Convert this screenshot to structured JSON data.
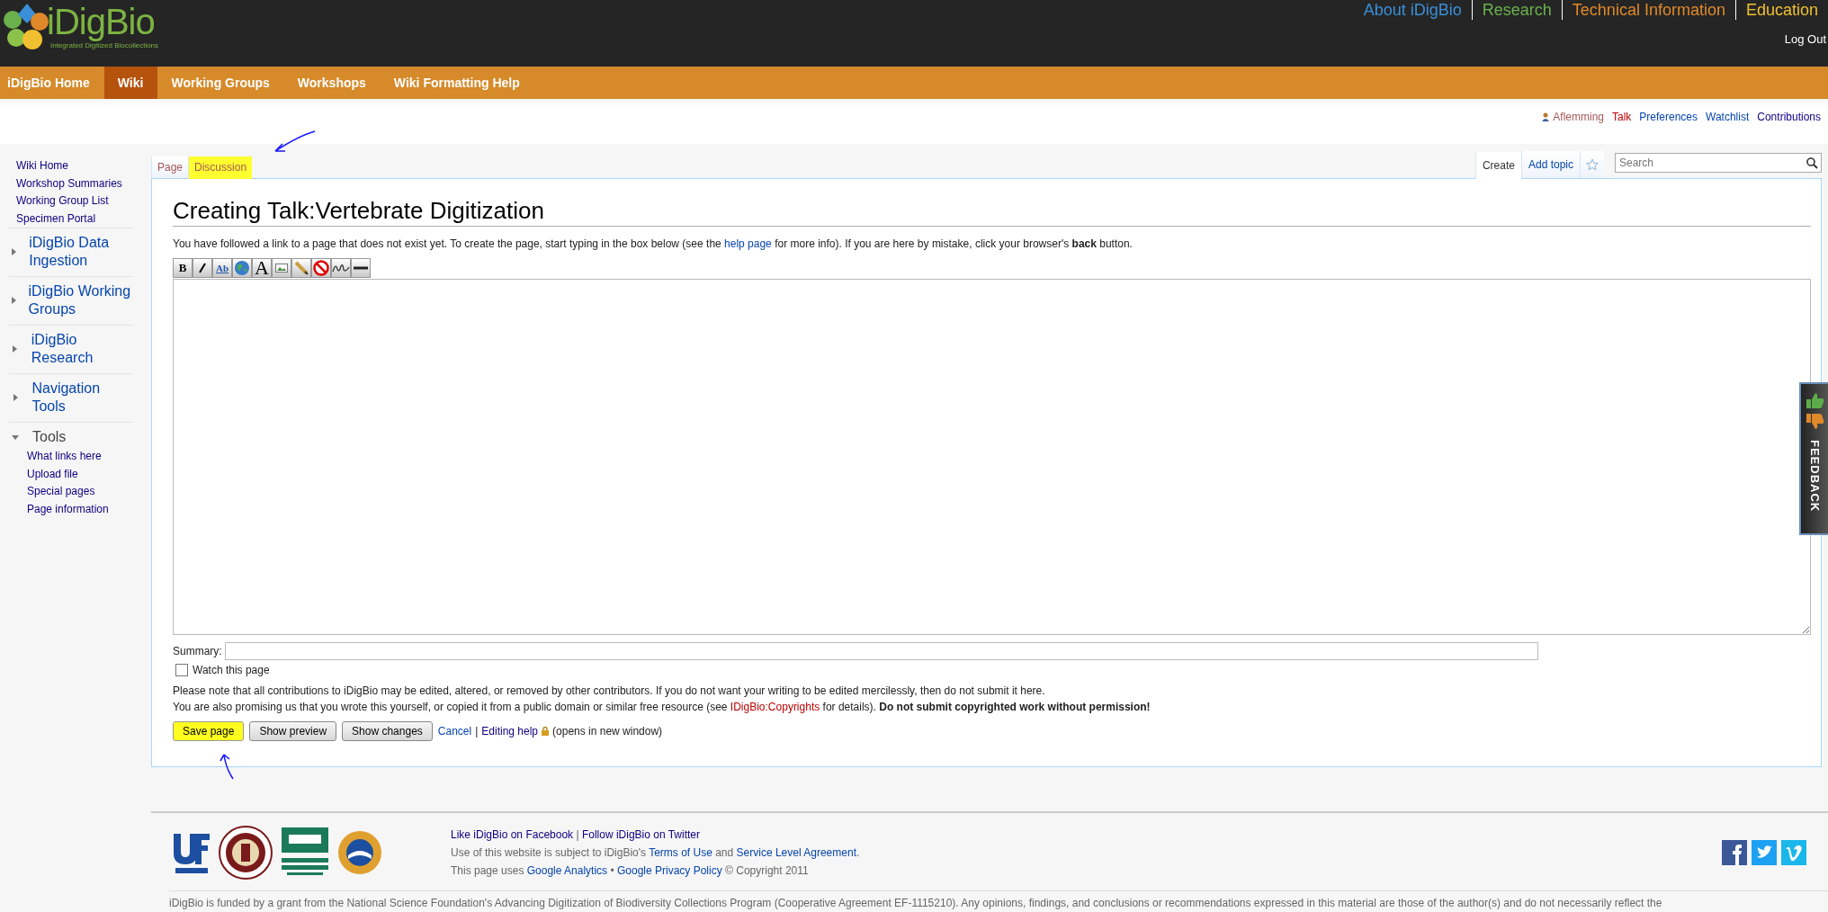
{
  "logo": {
    "name": "iDigBio",
    "tagline": "Integrated Digitized Biocollections"
  },
  "top_nav": [
    {
      "label": "About iDigBio",
      "color": "#3a8fd8"
    },
    {
      "label": "Research",
      "color": "#6ab04c"
    },
    {
      "label": "Technical Information",
      "color": "#e0892a"
    },
    {
      "label": "Education",
      "color": "#f0c030"
    }
  ],
  "logout": "Log Out",
  "main_nav": [
    {
      "label": "iDigBio Home",
      "selected": false
    },
    {
      "label": "Wiki",
      "selected": true
    },
    {
      "label": "Working Groups",
      "selected": false
    },
    {
      "label": "Workshops",
      "selected": false
    },
    {
      "label": "Wiki Formatting Help",
      "selected": false
    }
  ],
  "user_links": [
    {
      "label": "Aflemming",
      "kind": "user"
    },
    {
      "label": "Talk",
      "kind": "new"
    },
    {
      "label": "Preferences",
      "kind": "link"
    },
    {
      "label": "Watchlist",
      "kind": "link"
    },
    {
      "label": "Contributions",
      "kind": "visited"
    }
  ],
  "sidebar": {
    "links": [
      "Wiki Home",
      "Workshop Summaries",
      "Working Group List",
      "Specimen Portal"
    ],
    "portlets": [
      {
        "title": "iDigBio Data Ingestion",
        "expanded": false
      },
      {
        "title": "iDigBio Working Groups",
        "expanded": false
      },
      {
        "title": "iDigBio Research",
        "expanded": false
      },
      {
        "title": "Navigation Tools",
        "expanded": false
      },
      {
        "title": "Tools",
        "expanded": true,
        "children": [
          "What links here",
          "Upload file",
          "Special pages",
          "Page information"
        ]
      }
    ]
  },
  "tabs_left": [
    {
      "label": "Page",
      "selected": false,
      "highlighted": false
    },
    {
      "label": "Discussion",
      "selected": true,
      "highlighted": true
    }
  ],
  "tabs_right": [
    {
      "label": "Create",
      "selected": true
    },
    {
      "label": "Add topic",
      "selected": false
    }
  ],
  "search": {
    "placeholder": "Search"
  },
  "title": "Creating Talk:Vertebrate Digitization",
  "intro": {
    "before": "You have followed a link to a page that does not exist yet. To create the page, start typing in the box below (see the",
    "link": "help page",
    "after": "for more info). If you are here by mistake, click your browser's **back** button."
  },
  "toolbar": [
    {
      "kind": "bold",
      "label": "B"
    },
    {
      "kind": "italic"
    },
    {
      "kind": "link",
      "label": "Ab"
    },
    {
      "kind": "globe"
    },
    {
      "kind": "headline",
      "label": "A"
    },
    {
      "kind": "image"
    },
    {
      "kind": "media"
    },
    {
      "kind": "nowiki"
    },
    {
      "kind": "signature"
    },
    {
      "kind": "rule"
    }
  ],
  "summary": {
    "label": "Summary:"
  },
  "watch": {
    "label": "Watch this page",
    "checked": false
  },
  "notice1": "Please note that all contributions to iDigBio may be edited, altered, or removed by other contributors. If you do not want your writing to be edited mercilessly, then do not submit it here.",
  "notice2": {
    "before": "You are also promising us that you wrote this yourself, or copied it from a public domain or similar free resource (see",
    "link": "IDigBio:Copyrights",
    "after": "for details). **Do not submit copyrighted work without permission!**"
  },
  "buttons": [
    {
      "label": "Save page",
      "highlighted": true
    },
    {
      "label": "Show preview",
      "highlighted": false
    },
    {
      "label": "Show changes",
      "highlighted": false
    }
  ],
  "cancel": "Cancel",
  "sep": "|",
  "editing_help": "Editing help",
  "new_window": "(opens in new window)",
  "feedback": "FEEDBACK",
  "footer": {
    "line1": [
      {
        "label": "Like iDigBio on Facebook"
      },
      {
        "label": "|",
        "kind": "sep"
      },
      {
        "label": "Follow iDigBio on Twitter"
      }
    ],
    "line2": {
      "before": "Use of this website is subject to iDigBio's",
      "link1": "Terms of Use",
      "mid": "and",
      "link2": "Service Level Agreement",
      "after": "."
    },
    "line3": {
      "before": "This page uses",
      "link1": "Google Analytics",
      "mid": "•",
      "link2": "Google Privacy Policy",
      "after": "© Copyright 2011"
    },
    "funding": "iDigBio is funded by a grant from the National Science Foundation's Advancing Digitization of Biodiversity Collections Program (Cooperative Agreement EF-1115210). Any opinions, findings, and conclusions or recommendations expressed in this material are those of the author(s) and do not necessarily reflect the"
  }
}
